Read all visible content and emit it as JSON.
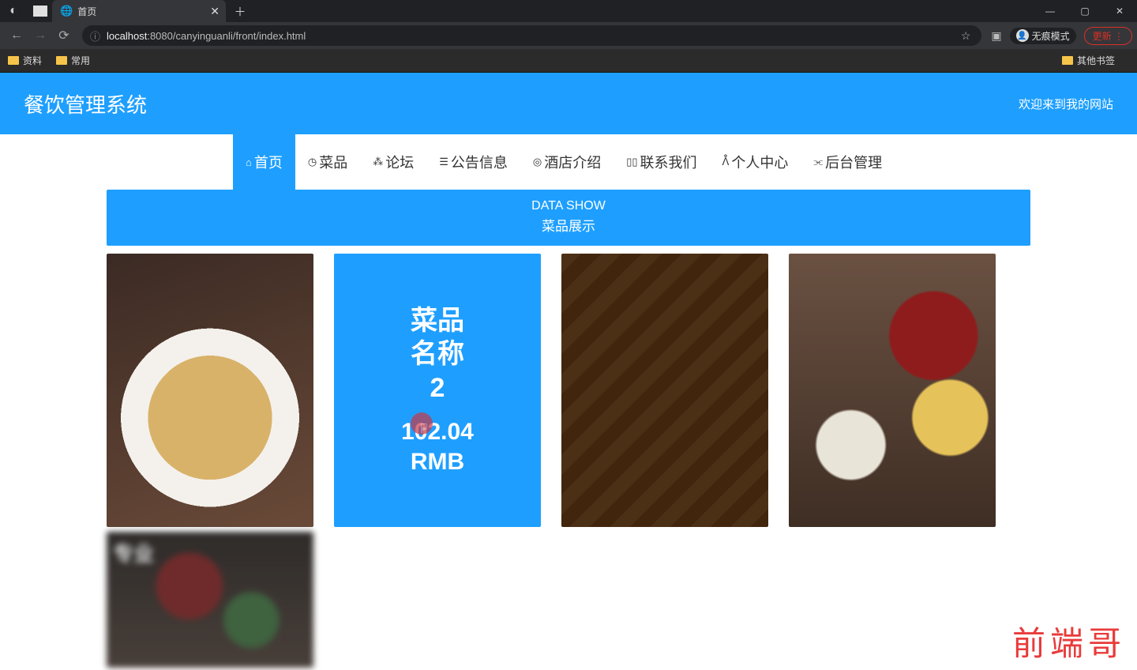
{
  "browser": {
    "tab_title": "首页",
    "url_host": "localhost",
    "url_port": ":8080",
    "url_path": "/canyinguanli/front/index.html",
    "incognito_label": "无痕模式",
    "update_label": "更新"
  },
  "bookmarks": {
    "b1": "资料",
    "b2": "常用",
    "other": "其他书签"
  },
  "site": {
    "title": "餐饮管理系统",
    "welcome": "欢迎来到我的网站"
  },
  "nav": {
    "items": [
      {
        "label": "首页"
      },
      {
        "label": "菜品"
      },
      {
        "label": "论坛"
      },
      {
        "label": "公告信息"
      },
      {
        "label": "酒店介绍"
      },
      {
        "label": "联系我们"
      },
      {
        "label": "个人中心"
      },
      {
        "label": "后台管理"
      }
    ]
  },
  "banner": {
    "en": "DATA SHOW",
    "cn": "菜品展示"
  },
  "hover_card": {
    "name_l1": "菜品",
    "name_l2": "名称",
    "name_l3": "2",
    "price_l1": "102.04",
    "price_l2": "RMB"
  },
  "row2_text": "专业",
  "watermark": "前端哥"
}
